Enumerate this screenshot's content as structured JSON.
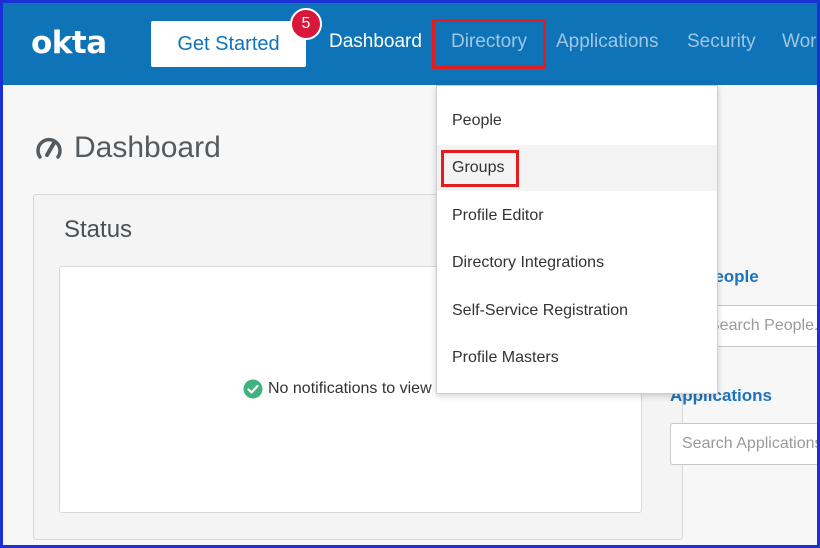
{
  "brand": {
    "logo": "okta"
  },
  "header": {
    "get_started_label": "Get Started",
    "notification_count": "5",
    "nav": [
      {
        "label": "Dashboard"
      },
      {
        "label": "Directory"
      },
      {
        "label": "Applications"
      },
      {
        "label": "Security"
      },
      {
        "label": "Wor"
      }
    ]
  },
  "directory_menu": {
    "items": [
      {
        "label": "People"
      },
      {
        "label": "Groups"
      },
      {
        "label": "Profile Editor"
      },
      {
        "label": "Directory Integrations"
      },
      {
        "label": "Self-Service Registration"
      },
      {
        "label": "Profile Masters"
      }
    ],
    "highlighted": "Groups"
  },
  "page": {
    "title": "Dashboard",
    "title_icon": "gauge-icon"
  },
  "status": {
    "heading": "Status",
    "message": "No notifications to view",
    "message_icon": "check-circle-icon"
  },
  "sidebar": {
    "people_label": "People",
    "people_placeholder": "Search People...",
    "applications_label": "Applications",
    "applications_placeholder": "Search Applications..."
  },
  "colors": {
    "header_bg": "#0f73b8",
    "badge": "#d8173a",
    "highlight_box": "#e21d1d",
    "link": "#1b74bd",
    "success": "#3fb27d"
  }
}
